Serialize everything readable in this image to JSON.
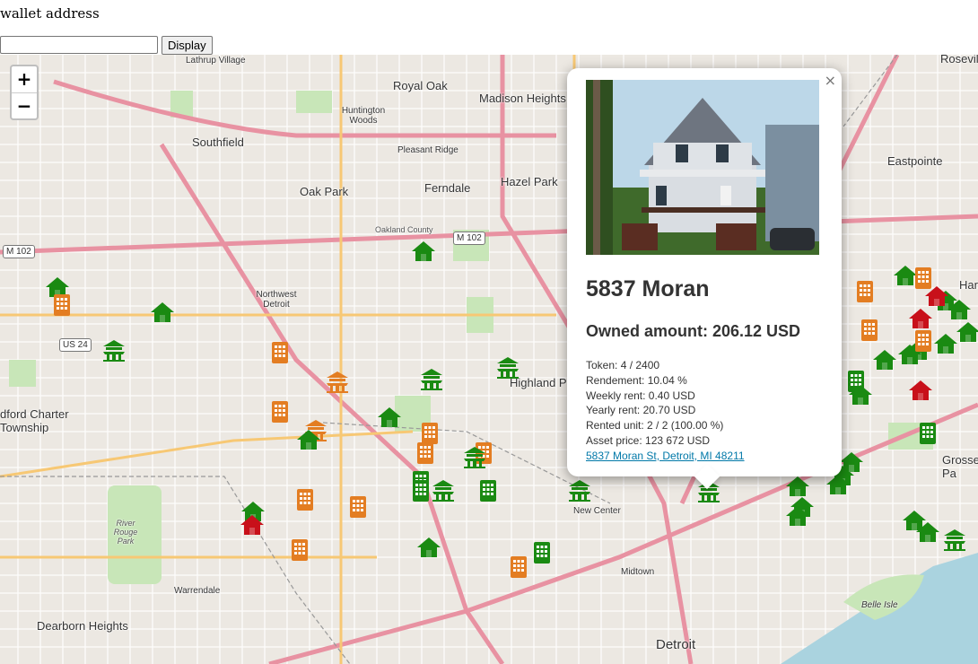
{
  "form": {
    "label": "wallet address",
    "input_value": "",
    "button_label": "Display"
  },
  "map": {
    "zoom_in": "+",
    "zoom_out": "−",
    "places": [
      {
        "name": "Lathrup Village",
        "size": "s"
      },
      {
        "name": "Royal Oak",
        "size": "l"
      },
      {
        "name": "Madison Heights",
        "size": "l"
      },
      {
        "name": "Huntington Woods",
        "size": "s"
      },
      {
        "name": "Southfield",
        "size": "l"
      },
      {
        "name": "Pleasant Ridge",
        "size": "s"
      },
      {
        "name": "Oak Park",
        "size": "l"
      },
      {
        "name": "Ferndale",
        "size": "l"
      },
      {
        "name": "Hazel Park",
        "size": "l"
      },
      {
        "name": "Oakland County",
        "size": "xs"
      },
      {
        "name": "Northwest Detroit",
        "size": "s"
      },
      {
        "name": "Highland P",
        "size": "l"
      },
      {
        "name": "dford Charter Township",
        "size": "l"
      },
      {
        "name": "River Rouge Park",
        "size": "xs"
      },
      {
        "name": "Warrendale",
        "size": "s"
      },
      {
        "name": "Dearborn Heights",
        "size": "l"
      },
      {
        "name": "New Center",
        "size": "s"
      },
      {
        "name": "Midtown",
        "size": "s"
      },
      {
        "name": "Detroit",
        "size": "l"
      },
      {
        "name": "Eastpointe",
        "size": "l"
      },
      {
        "name": "Roseville",
        "size": "l"
      },
      {
        "name": "Grosse Pa",
        "size": "l"
      },
      {
        "name": "Belle Isle",
        "size": "s"
      },
      {
        "name": "Har",
        "size": "l"
      }
    ],
    "shields": [
      "M 102",
      "M 102",
      "US 24"
    ],
    "markers_colors": {
      "green": "#1a8a12",
      "orange": "#e37d22",
      "red": "#c8101a"
    }
  },
  "popup": {
    "close": "×",
    "title": "5837 Moran",
    "owned": "Owned amount: 206.12 USD",
    "token": "Token: 4 / 2400",
    "rendement": "Rendement: 10.04 %",
    "weekly": "Weekly rent: 0.40 USD",
    "yearly": "Yearly rent: 20.70 USD",
    "rented": "Rented unit: 2 / 2 (100.00 %)",
    "price": "Asset price: 123 672 USD",
    "address_link": "5837 Moran St, Detroit, MI 48211"
  }
}
